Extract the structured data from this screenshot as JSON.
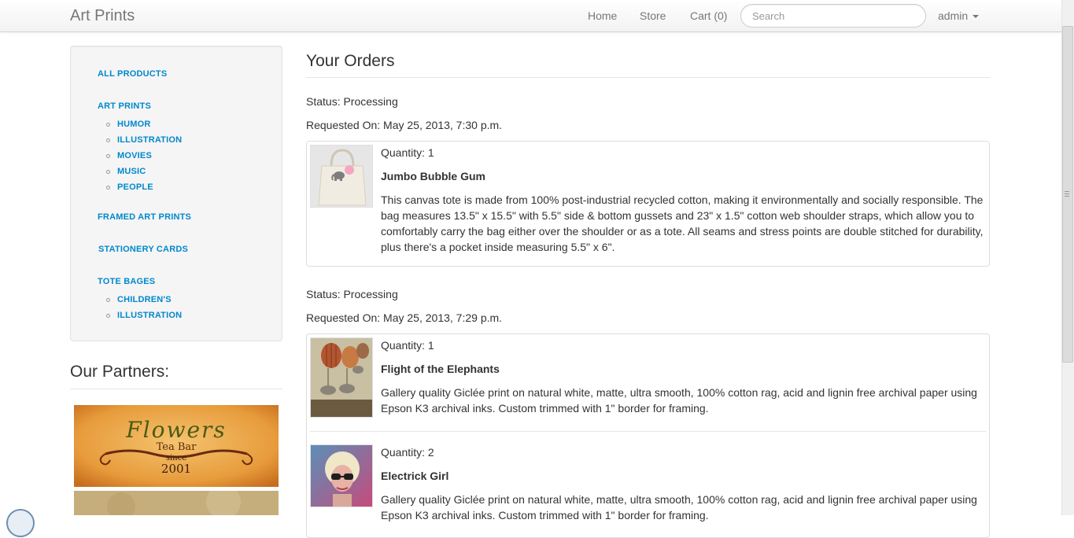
{
  "nav": {
    "brand": "Art Prints",
    "home": "Home",
    "store": "Store",
    "cart": "Cart (0)",
    "search_placeholder": "Search",
    "user": "admin"
  },
  "sidebar": {
    "categories": [
      {
        "label": "ALL PRODUCTS",
        "children": []
      },
      {
        "label": "ART PRINTS",
        "children": [
          "HUMOR",
          "ILLUSTRATION",
          "MOVIES",
          "MUSIC",
          "PEOPLE"
        ]
      },
      {
        "label": "FRAMED ART PRINTS",
        "children": []
      },
      {
        "label": "STATIONERY CARDS",
        "children": []
      },
      {
        "label": "TOTE BAGES",
        "children": [
          "CHILDREN'S",
          "ILLUSTRATION"
        ]
      }
    ],
    "partners_title": "Our Partners:",
    "partners": [
      {
        "line1": "Flowers",
        "line2": "Tea Bar",
        "line3": "since",
        "line4": "2001"
      }
    ]
  },
  "orders_title": "Your Orders",
  "orders": [
    {
      "status": "Status: Processing",
      "requested": "Requested On: May 25, 2013, 7:30 p.m.",
      "items": [
        {
          "quantity": "Quantity: 1",
          "name": "Jumbo Bubble Gum",
          "description": "This canvas tote is made from 100% post-industrial recycled cotton, making it environmentally and socially responsible. The bag measures 13.5\" x 15.5\" with 5.5\" side & bottom gussets and 23\" x 1.5\" cotton web shoulder straps, which allow you to comfortably carry the bag either over the shoulder or as a tote. All seams and stress points are double stitched for durability, plus there's a pocket inside measuring 5.5\" x 6\"."
        }
      ]
    },
    {
      "status": "Status: Processing",
      "requested": "Requested On: May 25, 2013, 7:29 p.m.",
      "items": [
        {
          "quantity": "Quantity: 1",
          "name": "Flight of the Elephants",
          "description": "Gallery quality Giclée print on natural white, matte, ultra smooth, 100% cotton rag, acid and lignin free archival paper using Epson K3 archival inks. Custom trimmed with 1\" border for framing."
        },
        {
          "quantity": "Quantity: 2",
          "name": "Electrick Girl",
          "description": "Gallery quality Giclée print on natural white, matte, ultra smooth, 100% cotton rag, acid and lignin free archival paper using Epson K3 archival inks. Custom trimmed with 1\" border for framing."
        }
      ]
    }
  ],
  "colors": {
    "link": "#0088cc",
    "navbar": "#f7f7f7",
    "text": "#333333"
  }
}
